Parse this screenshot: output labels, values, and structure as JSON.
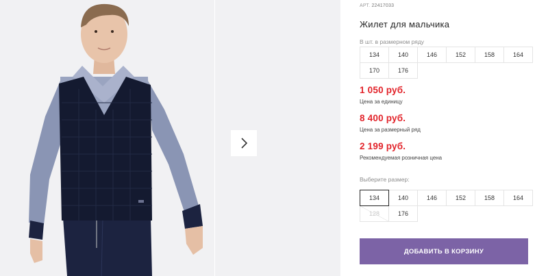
{
  "product": {
    "art_label": "АРТ.",
    "art_number": "22417033",
    "title": "Жилет для мальчика"
  },
  "size_row": {
    "label": "В шт. в размерном ряду",
    "sizes": [
      "134",
      "140",
      "146",
      "152",
      "158",
      "164",
      "170",
      "176"
    ]
  },
  "prices": {
    "unit_price": "1 050 руб.",
    "unit_note": "Цена за единицу",
    "row_price": "8 400 руб.",
    "row_note": "Цена за размерный ряд",
    "retail_price": "2 199 руб.",
    "retail_note": "Рекомендуемая розничная цена"
  },
  "size_select": {
    "label": "Выберите размер:",
    "sizes": [
      "134",
      "140",
      "146",
      "152",
      "158",
      "164",
      "128",
      "176"
    ],
    "selected": "134",
    "unavailable": [
      "128"
    ]
  },
  "cart": {
    "add_label": "ДОБАВИТЬ В КОРЗИНУ"
  },
  "colors": {
    "price": "#e2232a",
    "button": "#7c63a6",
    "photo_bg": "#f1f1f3"
  },
  "icons": {
    "next": "chevron-right-icon"
  }
}
